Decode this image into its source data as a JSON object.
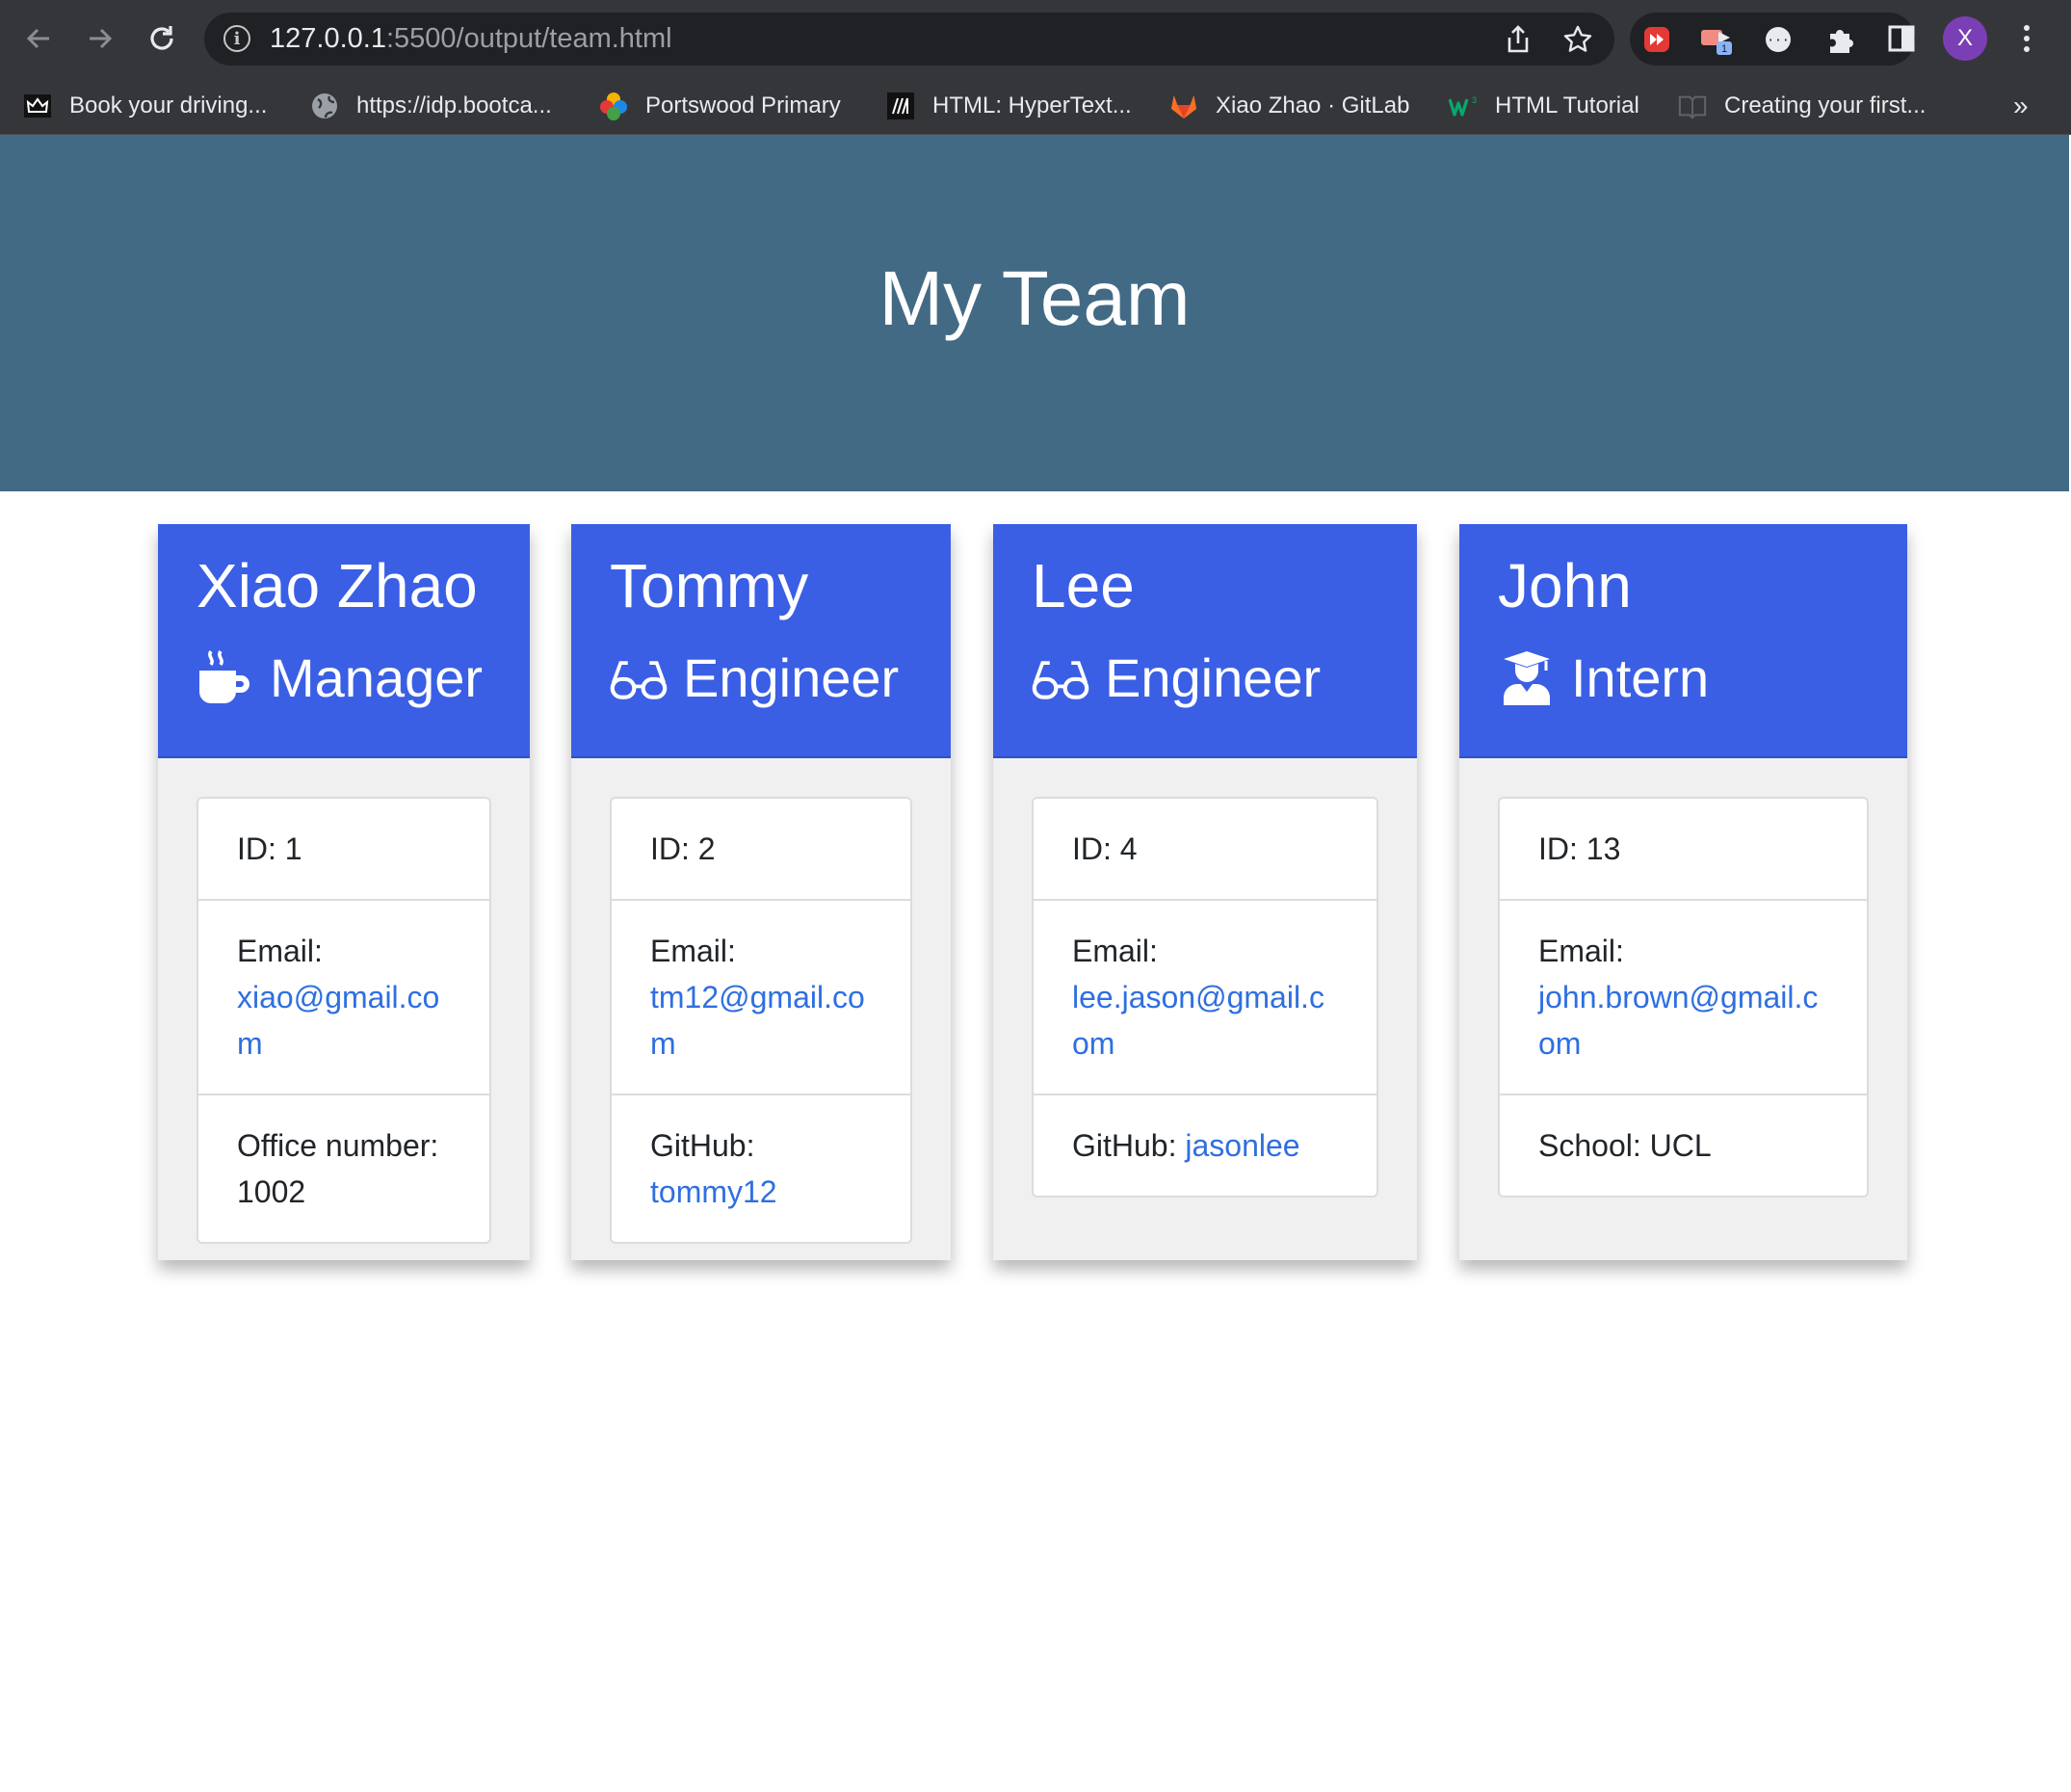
{
  "browser": {
    "url_host": "127.0.0.1",
    "url_path": ":5500/output/team.html",
    "extension_badge": "1",
    "profile_initial": "X",
    "bookmarks": [
      {
        "label": "Book your driving...",
        "icon": "crown-icon"
      },
      {
        "label": "https://idp.bootca...",
        "icon": "globe-icon"
      },
      {
        "label": "Portswood Primary",
        "icon": "flower-icon"
      },
      {
        "label": "HTML: HyperText...",
        "icon": "mdn-icon"
      },
      {
        "label": "Xiao Zhao · GitLab",
        "icon": "gitlab-icon"
      },
      {
        "label": "HTML Tutorial",
        "icon": "w3schools-icon"
      },
      {
        "label": "Creating your first...",
        "icon": "book-icon"
      }
    ],
    "more_bookmarks": "»"
  },
  "page": {
    "title": "My Team",
    "colors": {
      "hero": "#436a85",
      "card_header": "#3a5fe5",
      "link": "#2f6fe0"
    }
  },
  "team": [
    {
      "name": "Xiao Zhao",
      "role": "Manager",
      "role_icon": "coffee-mug-icon",
      "id_label": "ID:",
      "id": "1",
      "email_label": "Email:",
      "email": "xiao@gmail.com",
      "extra_label": "Office number:",
      "extra_value": "1002"
    },
    {
      "name": "Tommy",
      "role": "Engineer",
      "role_icon": "glasses-icon",
      "id_label": "ID:",
      "id": "2",
      "email_label": "Email:",
      "email": "tm12@gmail.com",
      "extra_label": "GitHub:",
      "extra_value": "tommy12"
    },
    {
      "name": "Lee",
      "role": "Engineer",
      "role_icon": "glasses-icon",
      "id_label": "ID:",
      "id": "4",
      "email_label": "Email:",
      "email": "lee.jason@gmail.com",
      "extra_label": "GitHub:",
      "extra_value": "jasonlee"
    },
    {
      "name": "John",
      "role": "Intern",
      "role_icon": "graduate-icon",
      "id_label": "ID:",
      "id": "13",
      "email_label": "Email:",
      "email": "john.brown@gmail.com",
      "extra_label": "School:",
      "extra_value": "UCL"
    }
  ]
}
